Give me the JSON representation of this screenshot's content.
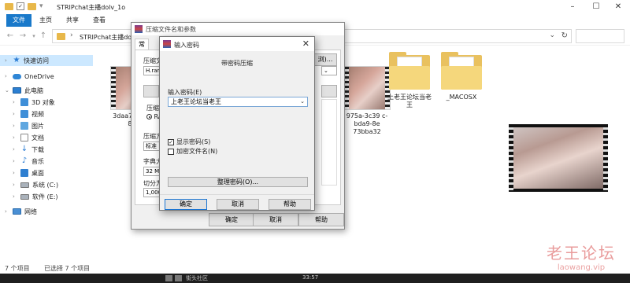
{
  "explorer": {
    "title": "STRIPchat主播dolv_1o",
    "ribbon_tabs": [
      "文件",
      "主页",
      "共享",
      "查看"
    ],
    "address_path": "STRIPchat主播dolv_1",
    "sidebar": [
      {
        "label": "快速访问"
      },
      {
        "label": "OneDrive"
      },
      {
        "label": "此电脑"
      },
      {
        "label": "3D 对象"
      },
      {
        "label": "视频"
      },
      {
        "label": "图片"
      },
      {
        "label": "文档"
      },
      {
        "label": "下载"
      },
      {
        "label": "音乐"
      },
      {
        "label": "桌面"
      },
      {
        "label": "系统 (C:)"
      },
      {
        "label": "软件 (E:)"
      },
      {
        "label": "网络"
      }
    ],
    "files": [
      {
        "name": "3daa7 4f19-8 8d0"
      },
      {
        "name": "975a-3c39 c-bda9-8e 73bba32"
      },
      {
        "name": "上老王论坛当老 王"
      },
      {
        "name": "_MACOSX"
      }
    ],
    "status": {
      "count": "7 个项目",
      "selected": "已选择 7 个项目"
    }
  },
  "rar_dialog": {
    "title": "压缩文件名和参数",
    "tab": "常规",
    "archive_label": "压缩文",
    "archive_value": "H.rar",
    "browse_label": "浏)...",
    "format_label": "压缩",
    "format_value": "RA",
    "method_label": "压缩方",
    "method_value": "标准",
    "dict_label": "字典大",
    "dict_value": "32 MB",
    "split_label": "切分为",
    "split_value": "1,000",
    "buttons": {
      "ok": "确定",
      "cancel": "取消",
      "help": "帮助"
    }
  },
  "password_dialog": {
    "title": "输入密码",
    "heading": "带密码压缩",
    "field_label": "输入密码(E)",
    "field_value": "上老王论坛当老王",
    "show_password": "显示密码(S)",
    "show_password_checked": true,
    "encrypt_names": "加密文件名(N)",
    "encrypt_names_checked": false,
    "organize_button": "整理密码(O)...",
    "buttons": {
      "ok": "确定",
      "cancel": "取消",
      "help": "帮助"
    }
  },
  "taskbar": {
    "item_text": "街头社区",
    "time": "33:57"
  },
  "watermark": {
    "line1": "老王论坛",
    "line2": "laowang.vip"
  },
  "colors": {
    "accent": "#1979ca",
    "folder": "#e9c15f",
    "selection": "#cce8ff",
    "watermark": "#e27a7a"
  }
}
